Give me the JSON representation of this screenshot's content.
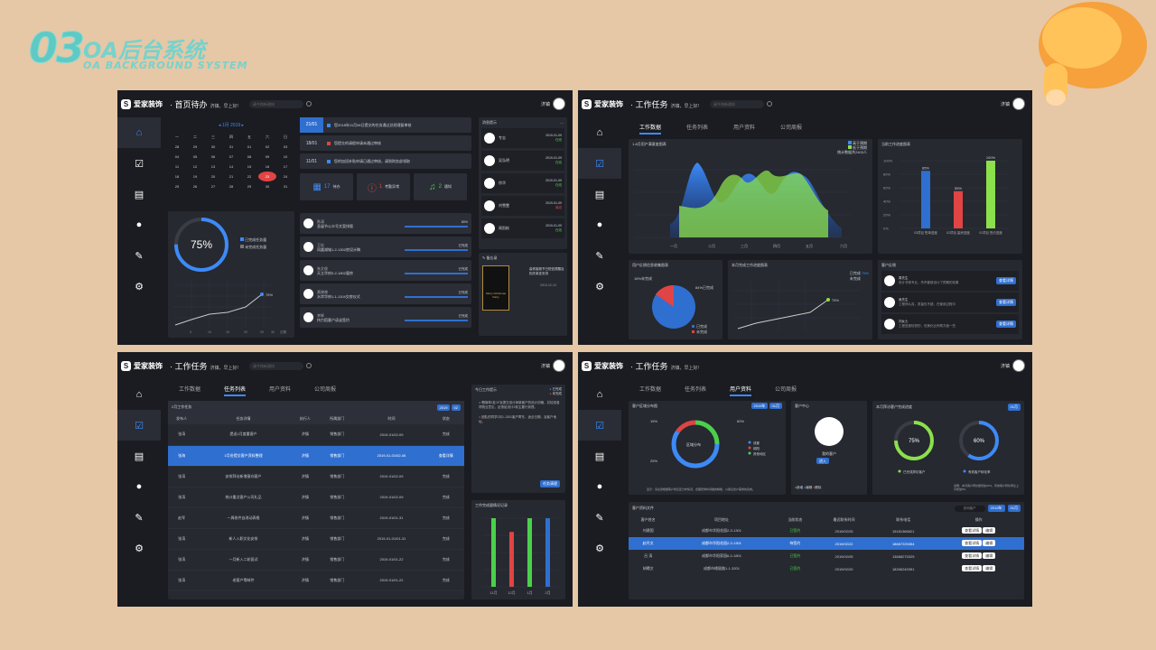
{
  "header": {
    "num": "03",
    "cn": "OA后台系统",
    "en": "OA BACKGROUND SYSTEM"
  },
  "brand": "爱家装饰",
  "user": "济镇",
  "greeting": "济镇，早上好!",
  "search_placeholder": "请今和新通知",
  "icons": [
    "home-icon",
    "task-icon",
    "contact-card-icon",
    "chat-icon",
    "report-icon",
    "settings-icon"
  ],
  "p1": {
    "title": "首页待办",
    "cal_month": "1月 2019",
    "weekdays": [
      "一",
      "二",
      "三",
      "四",
      "五",
      "六",
      "日"
    ],
    "cal_rows": [
      [
        "28",
        "29",
        "30",
        "31",
        "01",
        "02",
        "03"
      ],
      [
        "04",
        "05",
        "06",
        "07",
        "08",
        "09",
        "10"
      ],
      [
        "11",
        "12",
        "13",
        "14",
        "15",
        "16",
        "17"
      ],
      [
        "18",
        "19",
        "20",
        "21",
        "22",
        "23",
        "24"
      ],
      [
        "25",
        "26",
        "27",
        "28",
        "29",
        "30",
        "31"
      ]
    ],
    "notices": [
      {
        "date": "21/01",
        "text": "您2018年11月08日提交的任务通过总经理复审核"
      },
      {
        "date": "18/01",
        "text": "您提交的请假申请未通过审核"
      },
      {
        "date": "11/01",
        "text": "您的加班补贴申请已通过审核，请到财务部领取"
      }
    ],
    "stats": [
      {
        "n": "17",
        "l": "待办"
      },
      {
        "n": "1",
        "l": "考勤异常"
      },
      {
        "n": "2",
        "l": "通知"
      }
    ],
    "progress": "75%",
    "legend": [
      "已完成任务量",
      "未完成任务量"
    ],
    "line_label": "75%",
    "line_axis": [
      "5",
      "10",
      "15",
      "20",
      "25",
      "30",
      "日期"
    ],
    "tasks": [
      {
        "n": "陈清",
        "t": "圣诞节公众号文案排版",
        "s": "80%"
      },
      {
        "n": "王桂",
        "t": "凤凰湖城1-2-1302房设计稿",
        "s": "已完成"
      },
      {
        "n": "朱文俊",
        "t": "天立华府3-2-1802量房",
        "s": "已完成"
      },
      {
        "n": "黄晓晓",
        "t": "水岸华府1-1-1104交房仪式",
        "s": "已完成"
      },
      {
        "n": "李辉",
        "t": "持力稻客户读谈签约",
        "s": "已完成"
      }
    ],
    "msg_title": "消息提示",
    "msgs": [
      {
        "n": "专志",
        "d": "2019-01-09",
        "s": "在线"
      },
      {
        "n": "吴弘明",
        "d": "2019-01-09",
        "s": "在线"
      },
      {
        "n": "徐华",
        "d": "2019-01-09",
        "s": "在线"
      },
      {
        "n": "刘雪雯",
        "d": "2019-01-09",
        "s": "离线"
      },
      {
        "n": "周凯彬",
        "d": "2019-01-09",
        "s": "在线"
      }
    ],
    "memo_title": "备忘录",
    "memo_text": "装修客服节日短信提醒及相关事宜安排",
    "memo_date": "2019-12-10",
    "card_text": "Merry Christmas Party"
  },
  "p2": {
    "title": "工作任务",
    "tabs": [
      "工作数据",
      "任务列表",
      "用户资料",
      "公司周报"
    ],
    "c1_title": "1-6月用户满意度图表",
    "c1_legend": [
      "高于预期",
      "低于预期"
    ],
    "c1_total": "统计数据共2403人",
    "c1_months": [
      "一月",
      "二月",
      "三月",
      "四月",
      "五月",
      "六月"
    ],
    "c2_title": "当前工作进度图表",
    "c2_y": [
      "100%",
      "80%",
      "60%",
      "40%",
      "20%",
      "0%"
    ],
    "bars": [
      {
        "v": 85,
        "lbl": "85%",
        "name": "03项目 签单进度"
      },
      {
        "v": 55,
        "lbl": "55%",
        "name": "02项目 量房进度"
      },
      {
        "v": 100,
        "lbl": "100%",
        "name": "01项目 签约进度"
      }
    ],
    "pie_title": "用户反馈信息收集图表",
    "pie_lbl1": "16%未完成",
    "pie_lbl2": "84%已完成",
    "pie_legend": [
      "已完成",
      "未完成"
    ],
    "line_title": "本月完成工作进度图表",
    "line_legend": [
      "已完成",
      "未完成"
    ],
    "line_pct": "75%",
    "fb_title": "客户反馈",
    "fb": [
      {
        "n": "周先生",
        "t": "设计非常专业，杀杀都被设计了预期的效果"
      },
      {
        "n": "吴先生",
        "t": "工程师认真，质量也不错，在使用过程中"
      },
      {
        "n": "刘女士",
        "t": "工程进度较快的，但美化比例再方面一些"
      }
    ],
    "fb_btn": "查看详情"
  },
  "p3": {
    "title": "工作任务",
    "tabs": [
      "工作数据",
      "任务列表",
      "用户资料",
      "公司周报"
    ],
    "table_title": "2月工作任务",
    "year": "2019",
    "month": "02",
    "cols": [
      "发布人",
      "任务详情",
      "执行人",
      "所属部门",
      "时间",
      "状态"
    ],
    "rows": [
      [
        "张涛",
        "提送1月度重客户",
        "济镇",
        "销售部门",
        "2019-01/02-09",
        "完成"
      ],
      [
        "张海",
        "1月份提交客户资料整理",
        "济镇",
        "销售部门",
        "2019-01-01/02-06",
        "查看详情"
      ],
      [
        "张涛",
        "安排拜访新增意向客户",
        "济镇",
        "销售部门",
        "2019-01/02-09",
        "完成"
      ],
      [
        "张涛",
        "统计重点客户公司礼品",
        "济镇",
        "销售部门",
        "2019-01/02-09",
        "完成"
      ],
      [
        "赵军",
        "一周收件自改动表格",
        "济镇",
        "销售部门",
        "2019-01/01-31",
        "完成"
      ],
      [
        "张涛",
        "新人入职文化安排",
        "济镇",
        "销售部门",
        "2019-01-01/01-31",
        "完成"
      ],
      [
        "张涛",
        "一月新入二轮面试",
        "济镇",
        "销售部门",
        "2019-01/01-22",
        "完成"
      ],
      [
        "张涛",
        "老客户零邮件",
        "济镇",
        "销售部门",
        "2019-01/01-22",
        "完成"
      ]
    ],
    "today_title": "今日工作提示",
    "today_legend": [
      "已完成",
      "未完成"
    ],
    "today_items": [
      "喝咖啡1处1F及提交设计师新客户的设计初稿，并检查各项物业意见，反馈给设计2前主要行到提。",
      "团队的同学2月1-1301客户寄东，适合日期，及客户地址。"
    ],
    "today_btn": "任务清理",
    "chart_title": "工作完成量情况记录",
    "bars": [
      {
        "m": "11月",
        "v1": 100,
        "v2": 0
      },
      {
        "m": "12月",
        "v1": 80,
        "v2": 0
      },
      {
        "m": "1月",
        "v1": 100,
        "v2": 0
      },
      {
        "m": "2月",
        "v1": 100,
        "v2": 0
      }
    ]
  },
  "p4": {
    "title": "工作任务",
    "tabs": [
      "工作数据",
      "任务列表",
      "用户资料",
      "公司周报"
    ],
    "dist_title": "客户区域分布图",
    "dist_year": "2019年",
    "dist_month": "01月",
    "dist_center": "区域分布",
    "dist_pcts": [
      "15%",
      "60%",
      "25%"
    ],
    "dist_legend": [
      "成都",
      "绵阳",
      "其他地区"
    ],
    "dist_note": "显示：请注意根据客户所反区分布情况，合理安排时间相的精能，以保证合户需求的完成。",
    "center_title": "客户中心",
    "center_name": "我的客户",
    "center_btn": "进入",
    "center_legend": [
      "新增",
      "编辑",
      "删除"
    ],
    "rate_title": "本月拜访客户完成进度",
    "rate_month": "01月",
    "rate1": "75%",
    "rate2": "60%",
    "rate_legend": [
      "已完成拜访客户",
      "有效客户转化率"
    ],
    "rate_note": "说明：本月客户拜访量增加20%，有效客户转化率比上月增加5%",
    "file_title": "客户资料文件",
    "file_search": "查询客户",
    "file_year": "2019年",
    "file_month": "01月",
    "cols": [
      "客户姓名",
      "项目地址",
      "当前状态",
      "最近联系时间",
      "联系电话",
      "操作"
    ],
    "rows": [
      [
        "刘建国",
        "成都市华阳花园2-3-1301",
        "已签约",
        "2019/02/25",
        "15181366621"
      ],
      [
        "赵丹文",
        "成都市华阳花园2-3-1301",
        "待签约",
        "2019/02/22",
        "18687225354"
      ],
      [
        "吕 涛",
        "成都市华阳家园6-2-1801",
        "已签约",
        "2019/02/05",
        "13688275325"
      ],
      [
        "胡曦文",
        "成都市峨眉路1-1-3201",
        "已签约",
        "2019/02/20",
        "18266245351"
      ]
    ],
    "op1": "查看详情",
    "op2": "编辑"
  }
}
